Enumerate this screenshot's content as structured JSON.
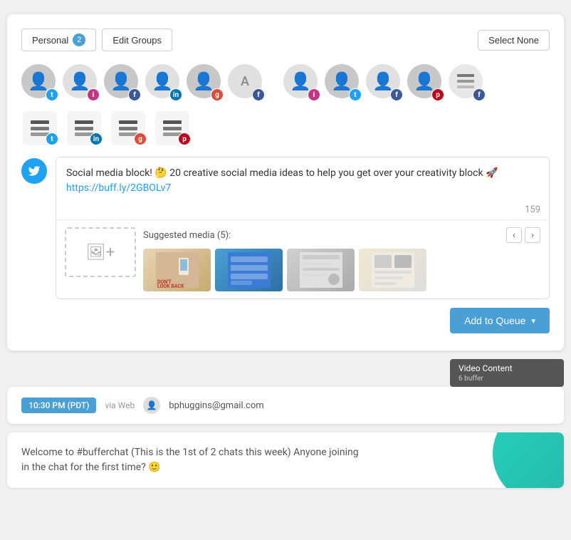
{
  "toolbar": {
    "personal_label": "Personal",
    "personal_count": "2",
    "edit_groups_label": "Edit Groups",
    "select_none_label": "Select None"
  },
  "avatars": [
    {
      "id": 1,
      "social": "twitter",
      "social_label": "t",
      "badge_class": "badge-twitter"
    },
    {
      "id": 2,
      "social": "instagram",
      "social_label": "i",
      "badge_class": "badge-instagram"
    },
    {
      "id": 3,
      "social": "facebook",
      "social_label": "f",
      "badge_class": "badge-facebook"
    },
    {
      "id": 4,
      "social": "linkedin",
      "social_label": "in",
      "badge_class": "badge-linkedin"
    },
    {
      "id": 5,
      "social": "google",
      "social_label": "g+",
      "badge_class": "badge-google"
    },
    {
      "id": 6,
      "letter": "A",
      "social": "facebook",
      "social_label": "f",
      "badge_class": "badge-facebook"
    },
    {
      "id": 7,
      "social": "instagram",
      "social_label": "i",
      "badge_class": "badge-instagram"
    },
    {
      "id": 8,
      "social": "twitter",
      "social_label": "t",
      "badge_class": "badge-twitter"
    },
    {
      "id": 9,
      "social": "facebook",
      "social_label": "f",
      "badge_class": "badge-facebook"
    },
    {
      "id": 10,
      "social": "pinterest",
      "social_label": "p",
      "badge_class": "badge-pinterest"
    },
    {
      "id": 11,
      "social": "facebook",
      "social_label": "f",
      "badge_class": "badge-facebook",
      "is_stack": true
    }
  ],
  "stacks": [
    {
      "id": 1,
      "social": "twitter",
      "badge_class": "badge-twitter"
    },
    {
      "id": 2,
      "social": "linkedin",
      "badge_class": "badge-linkedin"
    },
    {
      "id": 3,
      "social": "google",
      "badge_class": "badge-google"
    },
    {
      "id": 4,
      "social": "pinterest",
      "badge_class": "badge-pinterest"
    }
  ],
  "compose": {
    "twitter_handle": "twitter",
    "text": "Social media block! 🤔 20 creative social media ideas to help you get over your creativity block 🚀 ",
    "link": "https://buff.ly/2GBOLv7",
    "char_count": "159",
    "suggested_media_label": "Suggested media (5):"
  },
  "queue_button": {
    "label": "Add to Queue",
    "dropdown_icon": "▾"
  },
  "video_tooltip": {
    "title": "Video Content",
    "sub": "6 buffer"
  },
  "footer": {
    "time": "10:30 PM (PDT)",
    "via": "via Web",
    "user": "bphuggins@gmail.com"
  },
  "bottom_card": {
    "text": "Welcome to #bufferchat (This is the 1st of 2 chats this week) Anyone joining in the chat for the first time? 🙂"
  }
}
